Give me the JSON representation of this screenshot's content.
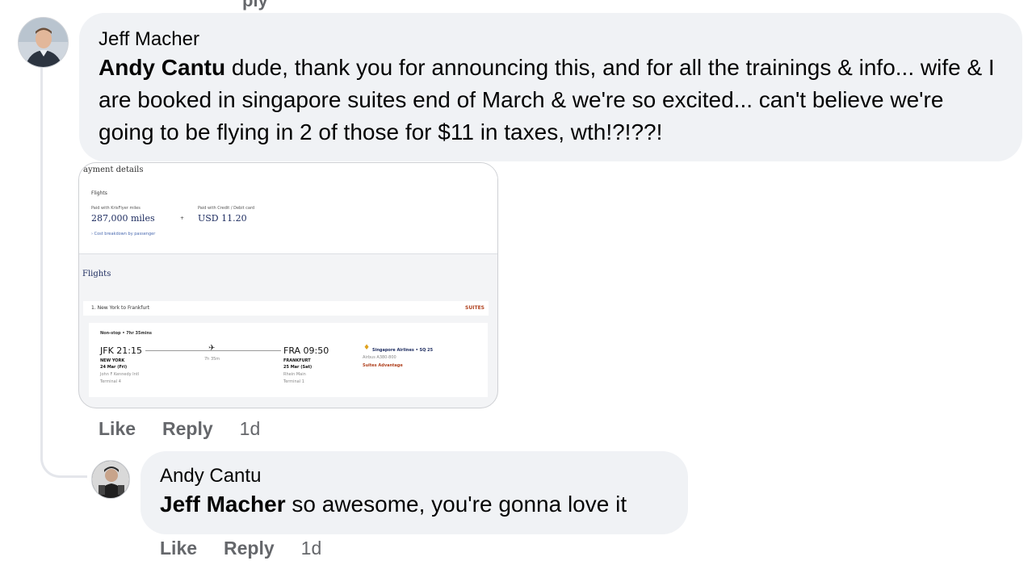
{
  "above_fragment": "ply",
  "comment": {
    "author": "Jeff Macher",
    "mention": "Andy Cantu",
    "text": " dude, thank you for announcing this, and for all the trainings & info... wife & I are booked in singapore suites end of March & we're so excited... can't believe we're going to be flying in 2 of those for $11 in taxes, wth!?!??!",
    "actions": {
      "like": "Like",
      "reply": "Reply",
      "time": "1d"
    },
    "attachment": {
      "heading": "ayment details",
      "flights_small_label": "Flights",
      "paid_miles_label": "Paid with KrisFlyer miles",
      "paid_miles_value": "287,000 miles",
      "plus": "+",
      "paid_card_label": "Paid with Credit / Debit card",
      "paid_card_value": "USD 11.20",
      "cost_breakdown": "› Cost breakdown by passenger",
      "flights_heading": "Flights",
      "route": "1. New York to Frankfurt",
      "cabin": "SUITES",
      "duration_header": "Non-stop • 7hr 35mins",
      "dep_time": "JFK 21:15",
      "dep_city": "NEW YORK",
      "dep_date": "24 Mar (Fri)",
      "dep_airport": "John F Kennedy Intl",
      "dep_terminal": "Terminal 4",
      "flight_duration": "7h 35m",
      "arr_time": "FRA 09:50",
      "arr_city": "FRANKFURT",
      "arr_date": "25 Mar (Sat)",
      "arr_airport": "Rhein Main",
      "arr_terminal": "Terminal 1",
      "airline": "Singapore Airlines • SQ 25",
      "aircraft": "Airbus A380-800",
      "fare_type": "Suites Advantage"
    }
  },
  "reply": {
    "author": "Andy Cantu",
    "mention": "Jeff Macher",
    "text": " so awesome, you're gonna love it",
    "actions": {
      "like": "Like",
      "reply": "Reply",
      "time": "1d"
    }
  },
  "colors": {
    "bubble_bg": "#f0f2f5",
    "meta_text": "#65676b",
    "thread_line": "#e4e6eb"
  }
}
